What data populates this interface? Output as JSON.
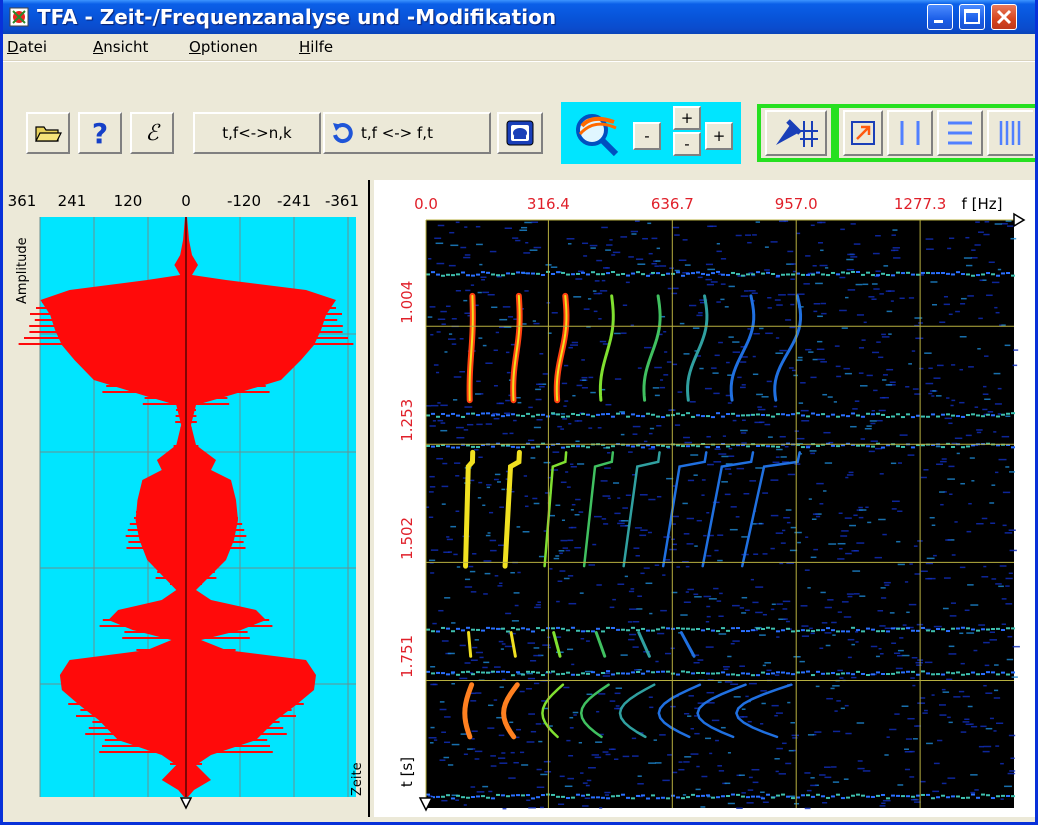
{
  "window": {
    "title": "TFA - Zeit-/Frequenzanalyse und -Modifikation"
  },
  "menu": {
    "items": [
      {
        "label": "Datei",
        "mnemonic": "D",
        "rest": "atei"
      },
      {
        "label": "Ansicht",
        "mnemonic": "A",
        "rest": "nsicht"
      },
      {
        "label": "Optionen",
        "mnemonic": "O",
        "rest": "ptionen"
      },
      {
        "label": "Hilfe",
        "mnemonic": "H",
        "rest": "ilfe"
      }
    ]
  },
  "toolbar": {
    "open_icon": "folder-open-icon",
    "help_icon": "question-icon",
    "info_label": "ꟓ",
    "tf_nk_label": "t,f<->n,k",
    "tf_ft_label": "t,f <-> f,t",
    "zoom_minus": "-",
    "zoom_plus": "+",
    "zoom_small_plus": "+",
    "zoom_small_minus": "-"
  },
  "waveform": {
    "top_ticks": [
      "361",
      "241",
      "120",
      "0",
      "-120",
      "-241",
      "-361"
    ],
    "ylabel": "Amplitude",
    "xlabel": "Zeite",
    "colors": {
      "background": "#00e5ff",
      "signal": "#ff0a0a",
      "grid": "#6a8f8f"
    }
  },
  "chart_data": {
    "type": "heatmap",
    "x_ticks": [
      "0.0",
      "316.4",
      "636.7",
      "957.0",
      "1277.3"
    ],
    "x_unit": "f [Hz]",
    "y_ticks": [
      "1.004",
      "1.253",
      "1.502",
      "1.751"
    ],
    "y_unit": "t [s]",
    "xlim": [
      0.0,
      1520
    ],
    "ylim": [
      0.78,
      2.02
    ],
    "grid": true,
    "colors": {
      "background": "#000000",
      "tick_text": "#e0202a",
      "grid": "#b8b040"
    }
  }
}
